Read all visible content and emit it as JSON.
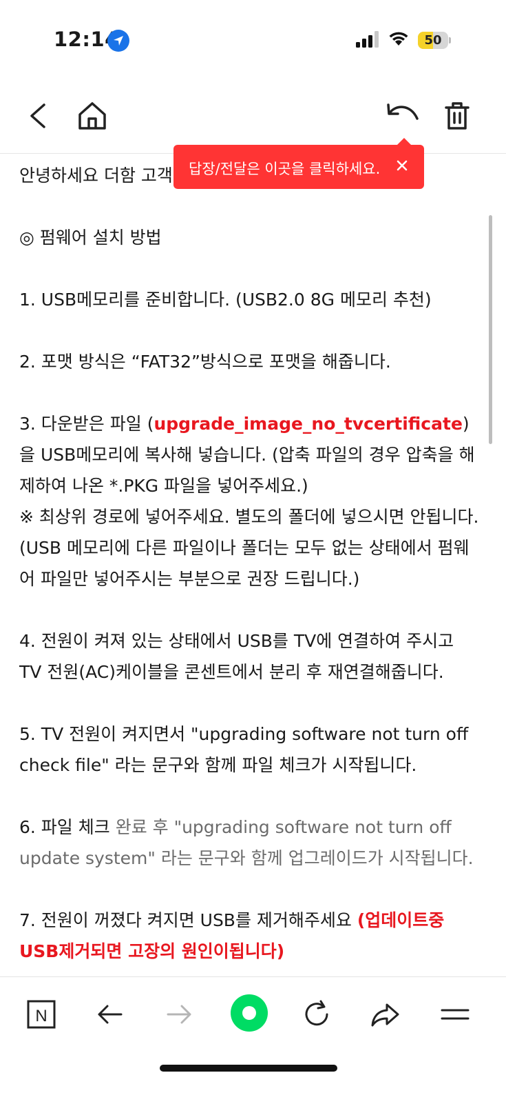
{
  "status_bar": {
    "time": "12:14",
    "battery_level": "50",
    "battery_fraction": 0.5,
    "battery_color": "#f5d22a"
  },
  "toolbar": {
    "icons": [
      "back-chevron-icon",
      "home-icon",
      "reply-icon",
      "trash-icon"
    ]
  },
  "tooltip": {
    "text": "답장/전달은 이곳을 클릭하세요.",
    "close_symbol": "×",
    "color": "#ff3434"
  },
  "content": {
    "greeting": "안녕하세요 더함 고객",
    "heading": "◎ 펌웨어 설치 방법",
    "step1": "1. USB메모리를 준비합니다. (USB2.0 8G 메모리 추천)",
    "step2": "2. 포맷 방식은 “FAT32”방식으로 포맷을 해줍니다.",
    "step3_prefix": "3. 다운받은 파일 (",
    "step3_filename": "upgrade_image_no_tvcertificate",
    "step3_suffix": ") 을 USB메모리에 복사해 넣습니다. (압축 파일의 경우 압축을 해제하여 나온 *.PKG 파일을 넣어주세요.)",
    "note": "※ 최상위 경로에 넣어주세요. 별도의 폴더에 넣으시면 안됩니다. (USB 메모리에 다른 파일이나 폴더는 모두 없는 상태에서 펌웨어 파일만 넣어주시는 부분으로 권장 드립니다.)",
    "step4": "4. 전원이 켜져 있는 상태에서 USB를 TV에 연결하여 주시고 TV 전원(AC)케이블을 콘센트에서 분리 후 재연결해줍니다.",
    "step5": "5. TV 전원이 켜지면서 \"upgrading software not turn off check file\" 라는 문구와 함께 파일 체크가 시작됩니다.",
    "step6_prefix": "6. 파일 체크",
    "step6_rest": " 완료 후 \"upgrading software not turn off update system\" 라는 문구와 함께 업그레이드가 시작됩니다.",
    "step7": "7. 전원이 꺼졌다 켜지면 USB를 제거해주세요  ",
    "step7_warning": "(업데이트중 USB제거되면 고장의 원인이됩니다)",
    "accent_color": "#e8171f"
  },
  "bottom_nav": {
    "n_label": "N",
    "icons": [
      "naver-n-icon",
      "back-arrow-icon",
      "forward-arrow-icon",
      "green-dot-icon",
      "refresh-icon",
      "share-icon",
      "menu-icon"
    ],
    "green_color": "#00dc64"
  }
}
